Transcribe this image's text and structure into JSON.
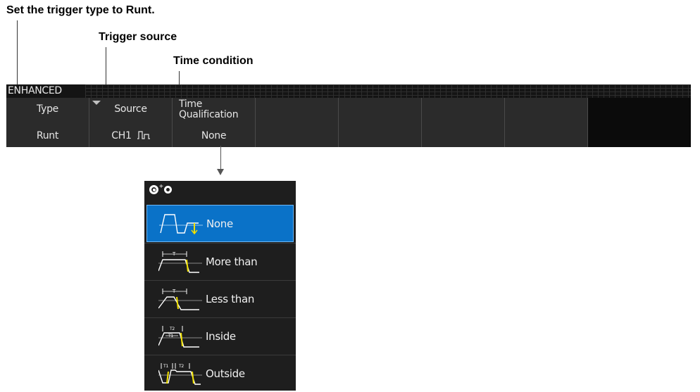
{
  "callouts": {
    "trigger_type": "Set the trigger type to Runt.",
    "trigger_source": "Trigger source",
    "time_condition": "Time condition"
  },
  "menu": {
    "mode": "ENHANCED",
    "keys": [
      {
        "title": "Type",
        "value": "Runt"
      },
      {
        "title": "Source",
        "value": "CH1"
      },
      {
        "title_line1": "Time",
        "title_line2": "Qualification",
        "value": "None"
      }
    ]
  },
  "dropdown": {
    "selected": "None",
    "options": [
      {
        "label": "None",
        "icon": "runt-waveform-icon"
      },
      {
        "label": "More than",
        "icon": "more-than-icon"
      },
      {
        "label": "Less than",
        "icon": "less-than-icon"
      },
      {
        "label": "Inside",
        "icon": "inside-icon"
      },
      {
        "label": "Outside",
        "icon": "outside-icon"
      }
    ]
  },
  "colors": {
    "accent": "#0a72c8",
    "waveform_highlight": "#f0e000",
    "panel_bg": "#1e1e1e",
    "softkey_bg": "#2b2b2b"
  }
}
